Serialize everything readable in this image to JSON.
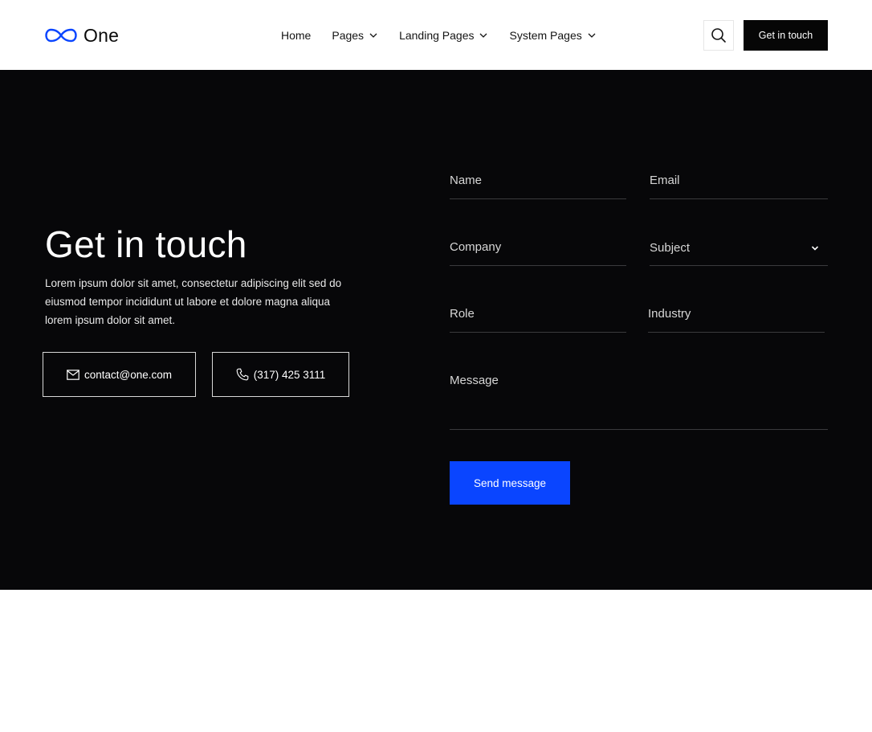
{
  "brand": {
    "name": "One",
    "logo_icon": "infinity-icon",
    "accent": "#0a45ff"
  },
  "nav": {
    "items": [
      {
        "label": "Home",
        "has_dropdown": false
      },
      {
        "label": "Pages",
        "has_dropdown": true
      },
      {
        "label": "Landing Pages",
        "has_dropdown": true
      },
      {
        "label": "System Pages",
        "has_dropdown": true
      }
    ],
    "search_icon": "search-icon",
    "cta_label": "Get in touch"
  },
  "hero": {
    "title": "Get in touch",
    "description": "Lorem ipsum dolor sit amet, consectetur adipiscing elit sed do eiusmod tempor incididunt ut labore et dolore magna aliqua lorem ipsum dolor sit amet.",
    "email": "contact@one.com",
    "phone": "(317) 425 3111",
    "background": "#070709"
  },
  "form": {
    "name_placeholder": "Name",
    "email_placeholder": "Email",
    "company_placeholder": "Company",
    "subject_label": "Subject",
    "role_placeholder": "Role",
    "industry_placeholder": "Industry",
    "message_placeholder": "Message",
    "submit_label": "Send message"
  }
}
